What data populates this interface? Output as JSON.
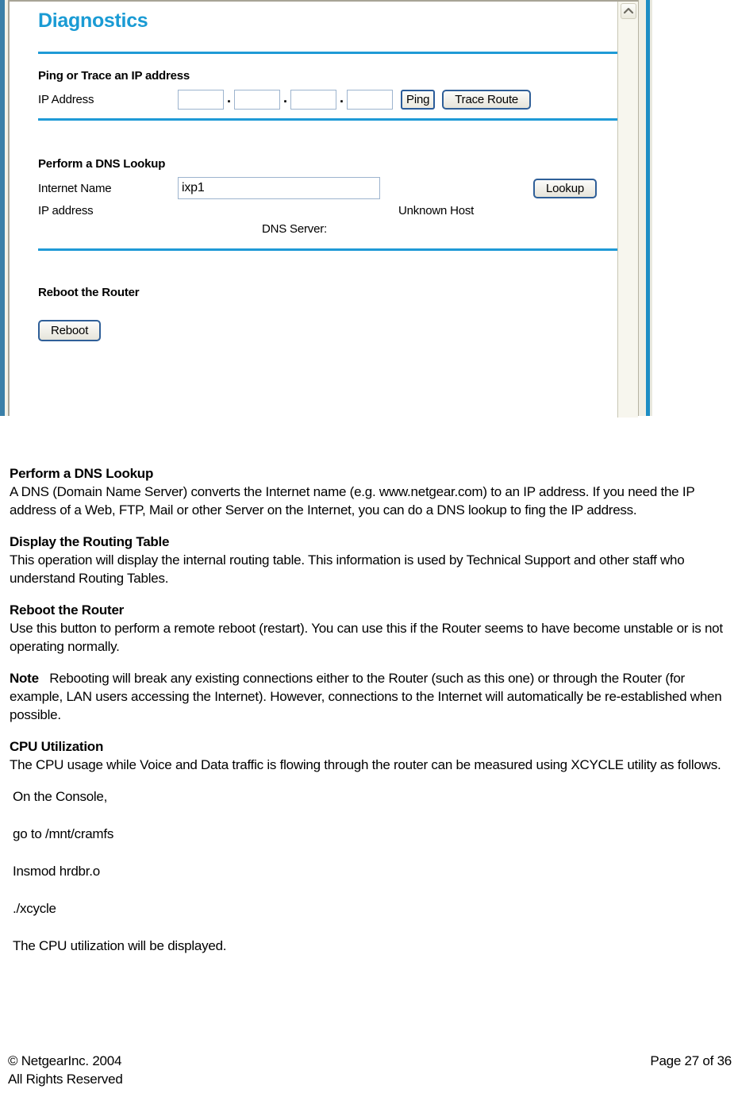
{
  "screenshot": {
    "title": "Diagnostics",
    "scroll_up_icon": "chevron-up-icon",
    "ping_section": {
      "heading": "Ping or Trace an IP address",
      "ip_label": "IP Address",
      "octets": [
        "",
        "",
        "",
        ""
      ],
      "separator": ".",
      "ping_button": "Ping",
      "trace_route_button": "Trace Route"
    },
    "dns_section": {
      "heading": "Perform a DNS Lookup",
      "internet_name_label": "Internet Name",
      "internet_name_value": "ixp1",
      "lookup_button": "Lookup",
      "ip_address_label": "IP address",
      "ip_address_value": "Unknown Host",
      "dns_server_label": "DNS Server:",
      "dns_server_value": ""
    },
    "reboot_section": {
      "heading": "Reboot the Router",
      "reboot_button": "Reboot"
    },
    "accent_color": "#1f9ad6",
    "title_color": "#1a9bd4"
  },
  "document": {
    "sections": [
      {
        "heading": "Perform a DNS Lookup",
        "body": "A DNS (Domain Name Server) converts the Internet name (e.g. www.netgear.com) to an IP address. If you need the IP address of a Web, FTP, Mail or other Server on the Internet, you can do a DNS lookup to fing the IP address."
      },
      {
        "heading": "Display the Routing Table",
        "body": "This operation will display the internal routing table. This information is used by Technical Support and other staff who understand Routing Tables."
      },
      {
        "heading": "Reboot the Router",
        "body": "Use this button to perform a remote reboot (restart). You can use this if the Router seems to have become unstable or is not operating normally."
      }
    ],
    "note": {
      "label": "Note",
      "body": "Rebooting will break any existing connections either to the Router (such as this one) or through the Router (for example, LAN users accessing the Internet). However, connections to the Internet will automatically be re-established when possible."
    },
    "cpu_section": {
      "heading": "CPU Utilization",
      "body": "The CPU usage while Voice and Data traffic is flowing through the router can be measured using XCYCLE utility as follows."
    },
    "steps": [
      "On the Console,",
      "go to /mnt/cramfs",
      "Insmod hrdbr.o",
      "./xcycle",
      "The CPU utilization will be displayed."
    ]
  },
  "footer": {
    "copyright_line1": "© NetgearInc. 2004",
    "copyright_line2": "All Rights Reserved",
    "page_number": "Page 27 of 36"
  }
}
